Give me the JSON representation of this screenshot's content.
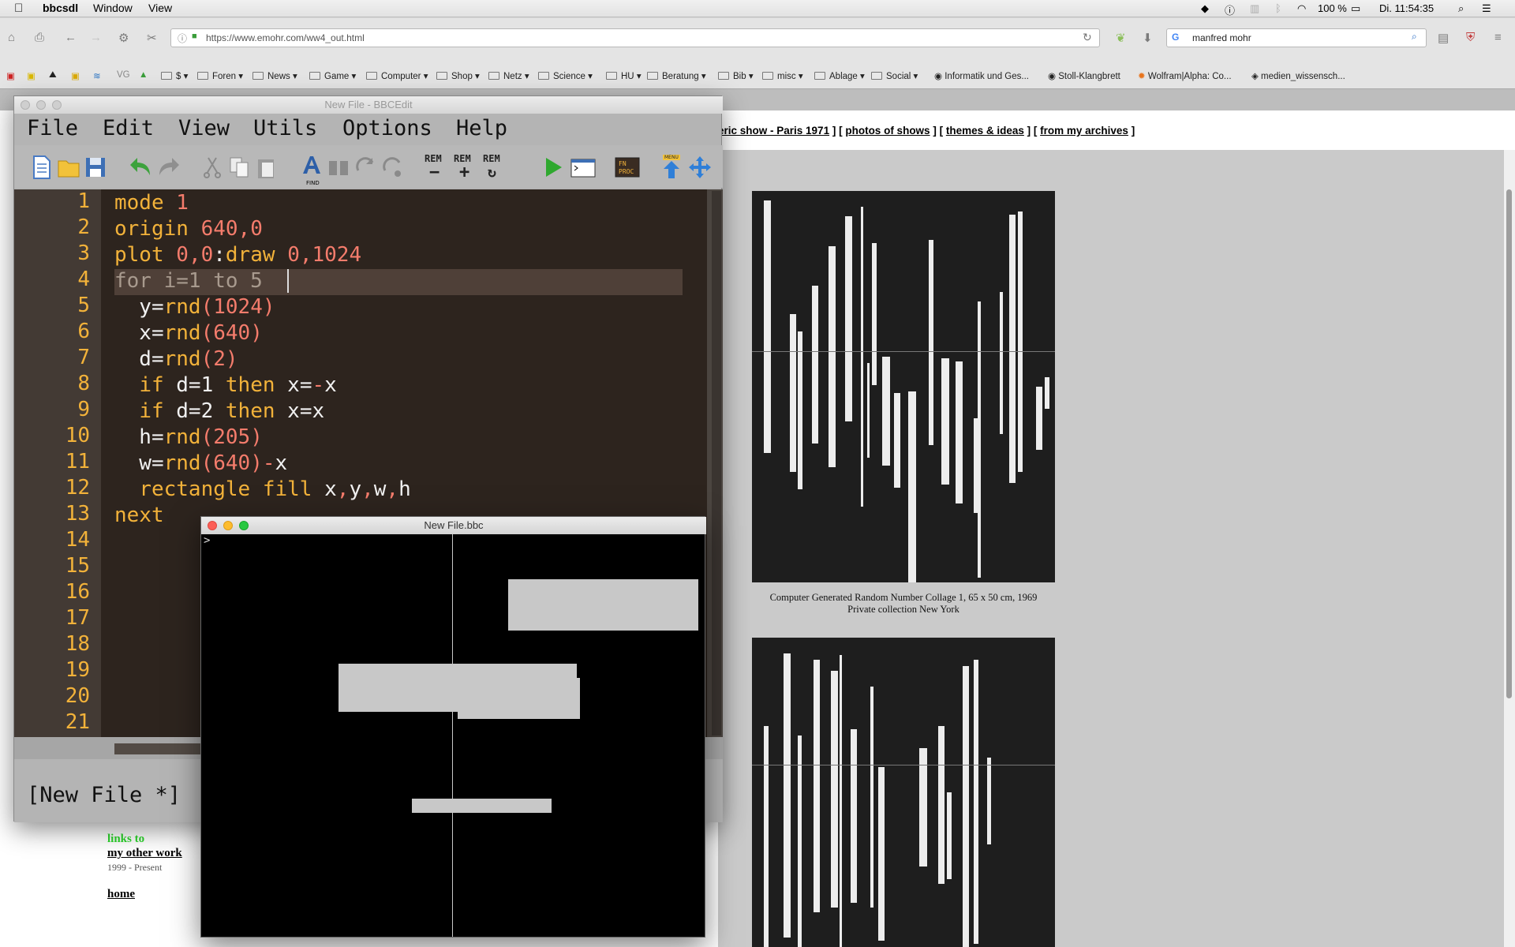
{
  "menubar": {
    "app": "bbcsdl",
    "items": [
      "Window",
      "View"
    ],
    "battery": "100 %",
    "clock": "Di. 11:54:35"
  },
  "browser": {
    "url": "https://www.emohr.com/ww4_out.html",
    "search_query": "manfred mohr",
    "bookmarks": [
      "VG",
      "$",
      "Foren",
      "News",
      "Game",
      "Computer",
      "Shop",
      "Netz",
      "Science",
      "HU",
      "Beratung",
      "Bib",
      "misc",
      "Ablage",
      "Social",
      "Informatik und Ges...",
      "Stoll-Klangbrett",
      "Wolfram|Alpha: Co...",
      "medien_wissensch..."
    ]
  },
  "page": {
    "nav_prefix": "eric show - Paris 1971",
    "nav_links": [
      "photos of shows",
      "themes & ideas",
      "from my archives"
    ],
    "caption1_line1": "Computer Generated Random Number Collage 1, 65 x 50 cm, 1969",
    "caption1_line2": "Private collection New York",
    "links_to": "links to",
    "my_other_work": "my other work",
    "years": "1999 - Present",
    "home": "home"
  },
  "editor": {
    "title": "New File - BBCEdit",
    "menu": [
      "File",
      "Edit",
      "View",
      "Utils",
      "Options",
      "Help"
    ],
    "rem_labels": [
      "REM",
      "REM",
      "REM"
    ],
    "find_label": "FIND",
    "menu_label": "MENU",
    "fnproc_label": "FN PROC",
    "line_numbers": [
      "1",
      "2",
      "3",
      "4",
      "5",
      "6",
      "7",
      "8",
      "9",
      "10",
      "11",
      "12",
      "13",
      "14",
      "15",
      "16",
      "17",
      "18",
      "19",
      "20",
      "21"
    ],
    "status": "[New File *]"
  },
  "output_window": {
    "title": "New File.bbc",
    "prompt": ">"
  },
  "colors": {
    "keyword": "#f2b23a",
    "number": "#f47c6c",
    "editor_bg": "#2d241e"
  }
}
